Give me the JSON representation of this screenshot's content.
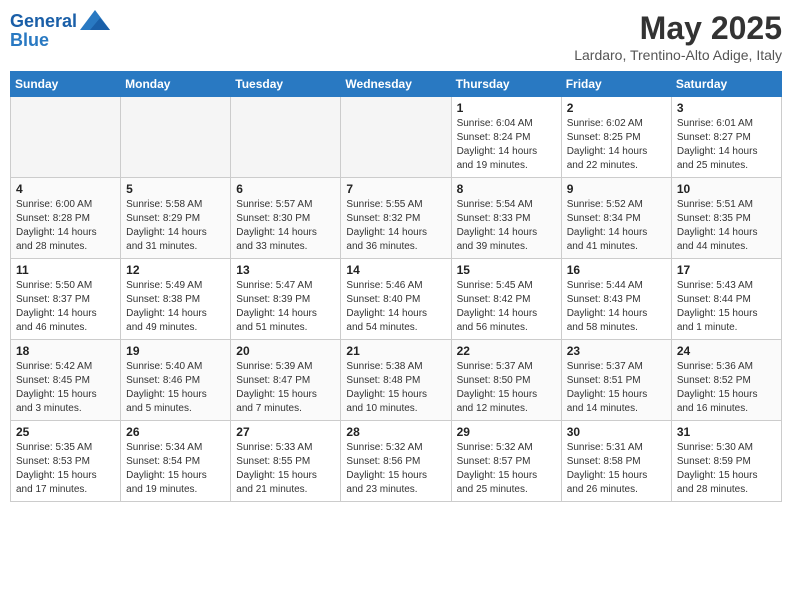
{
  "header": {
    "logo_line1": "General",
    "logo_line2": "Blue",
    "month_title": "May 2025",
    "location": "Lardaro, Trentino-Alto Adige, Italy"
  },
  "days_of_week": [
    "Sunday",
    "Monday",
    "Tuesday",
    "Wednesday",
    "Thursday",
    "Friday",
    "Saturday"
  ],
  "weeks": [
    [
      {
        "day": "",
        "content": ""
      },
      {
        "day": "",
        "content": ""
      },
      {
        "day": "",
        "content": ""
      },
      {
        "day": "",
        "content": ""
      },
      {
        "day": "1",
        "content": "Sunrise: 6:04 AM\nSunset: 8:24 PM\nDaylight: 14 hours\nand 19 minutes."
      },
      {
        "day": "2",
        "content": "Sunrise: 6:02 AM\nSunset: 8:25 PM\nDaylight: 14 hours\nand 22 minutes."
      },
      {
        "day": "3",
        "content": "Sunrise: 6:01 AM\nSunset: 8:27 PM\nDaylight: 14 hours\nand 25 minutes."
      }
    ],
    [
      {
        "day": "4",
        "content": "Sunrise: 6:00 AM\nSunset: 8:28 PM\nDaylight: 14 hours\nand 28 minutes."
      },
      {
        "day": "5",
        "content": "Sunrise: 5:58 AM\nSunset: 8:29 PM\nDaylight: 14 hours\nand 31 minutes."
      },
      {
        "day": "6",
        "content": "Sunrise: 5:57 AM\nSunset: 8:30 PM\nDaylight: 14 hours\nand 33 minutes."
      },
      {
        "day": "7",
        "content": "Sunrise: 5:55 AM\nSunset: 8:32 PM\nDaylight: 14 hours\nand 36 minutes."
      },
      {
        "day": "8",
        "content": "Sunrise: 5:54 AM\nSunset: 8:33 PM\nDaylight: 14 hours\nand 39 minutes."
      },
      {
        "day": "9",
        "content": "Sunrise: 5:52 AM\nSunset: 8:34 PM\nDaylight: 14 hours\nand 41 minutes."
      },
      {
        "day": "10",
        "content": "Sunrise: 5:51 AM\nSunset: 8:35 PM\nDaylight: 14 hours\nand 44 minutes."
      }
    ],
    [
      {
        "day": "11",
        "content": "Sunrise: 5:50 AM\nSunset: 8:37 PM\nDaylight: 14 hours\nand 46 minutes."
      },
      {
        "day": "12",
        "content": "Sunrise: 5:49 AM\nSunset: 8:38 PM\nDaylight: 14 hours\nand 49 minutes."
      },
      {
        "day": "13",
        "content": "Sunrise: 5:47 AM\nSunset: 8:39 PM\nDaylight: 14 hours\nand 51 minutes."
      },
      {
        "day": "14",
        "content": "Sunrise: 5:46 AM\nSunset: 8:40 PM\nDaylight: 14 hours\nand 54 minutes."
      },
      {
        "day": "15",
        "content": "Sunrise: 5:45 AM\nSunset: 8:42 PM\nDaylight: 14 hours\nand 56 minutes."
      },
      {
        "day": "16",
        "content": "Sunrise: 5:44 AM\nSunset: 8:43 PM\nDaylight: 14 hours\nand 58 minutes."
      },
      {
        "day": "17",
        "content": "Sunrise: 5:43 AM\nSunset: 8:44 PM\nDaylight: 15 hours\nand 1 minute."
      }
    ],
    [
      {
        "day": "18",
        "content": "Sunrise: 5:42 AM\nSunset: 8:45 PM\nDaylight: 15 hours\nand 3 minutes."
      },
      {
        "day": "19",
        "content": "Sunrise: 5:40 AM\nSunset: 8:46 PM\nDaylight: 15 hours\nand 5 minutes."
      },
      {
        "day": "20",
        "content": "Sunrise: 5:39 AM\nSunset: 8:47 PM\nDaylight: 15 hours\nand 7 minutes."
      },
      {
        "day": "21",
        "content": "Sunrise: 5:38 AM\nSunset: 8:48 PM\nDaylight: 15 hours\nand 10 minutes."
      },
      {
        "day": "22",
        "content": "Sunrise: 5:37 AM\nSunset: 8:50 PM\nDaylight: 15 hours\nand 12 minutes."
      },
      {
        "day": "23",
        "content": "Sunrise: 5:37 AM\nSunset: 8:51 PM\nDaylight: 15 hours\nand 14 minutes."
      },
      {
        "day": "24",
        "content": "Sunrise: 5:36 AM\nSunset: 8:52 PM\nDaylight: 15 hours\nand 16 minutes."
      }
    ],
    [
      {
        "day": "25",
        "content": "Sunrise: 5:35 AM\nSunset: 8:53 PM\nDaylight: 15 hours\nand 17 minutes."
      },
      {
        "day": "26",
        "content": "Sunrise: 5:34 AM\nSunset: 8:54 PM\nDaylight: 15 hours\nand 19 minutes."
      },
      {
        "day": "27",
        "content": "Sunrise: 5:33 AM\nSunset: 8:55 PM\nDaylight: 15 hours\nand 21 minutes."
      },
      {
        "day": "28",
        "content": "Sunrise: 5:32 AM\nSunset: 8:56 PM\nDaylight: 15 hours\nand 23 minutes."
      },
      {
        "day": "29",
        "content": "Sunrise: 5:32 AM\nSunset: 8:57 PM\nDaylight: 15 hours\nand 25 minutes."
      },
      {
        "day": "30",
        "content": "Sunrise: 5:31 AM\nSunset: 8:58 PM\nDaylight: 15 hours\nand 26 minutes."
      },
      {
        "day": "31",
        "content": "Sunrise: 5:30 AM\nSunset: 8:59 PM\nDaylight: 15 hours\nand 28 minutes."
      }
    ]
  ]
}
